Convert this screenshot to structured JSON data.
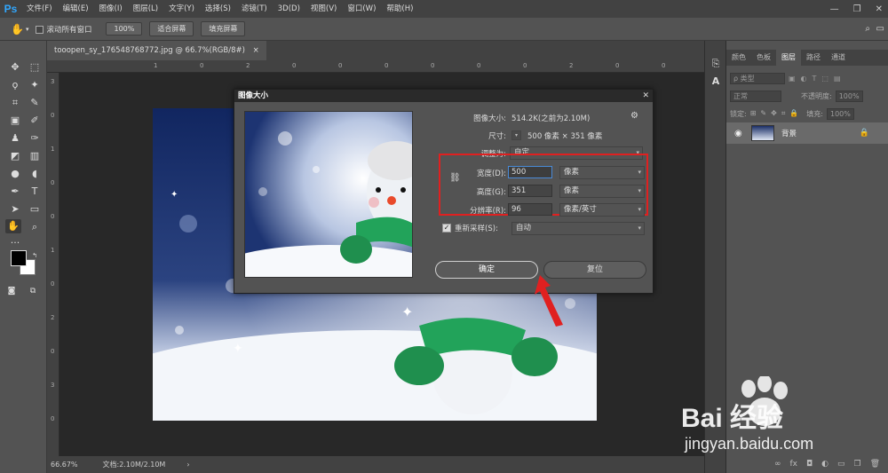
{
  "app": {
    "logo": "Ps",
    "window_controls": [
      "—",
      "❐",
      "✕"
    ]
  },
  "menu": [
    "文件(F)",
    "编辑(E)",
    "图像(I)",
    "图层(L)",
    "文字(Y)",
    "选择(S)",
    "滤镜(T)",
    "3D(D)",
    "视图(V)",
    "窗口(W)",
    "帮助(H)"
  ],
  "options_bar": {
    "scroll_all": "滚动所有窗口",
    "zoom_100": "100%",
    "fit_screen": "适合屏幕",
    "fill_screen": "填充屏幕"
  },
  "document": {
    "tab": "tooopen_sy_176548768772.jpg @ 66.7%(RGB/8#)",
    "close": "×"
  },
  "rulers": {
    "top": [
      "1",
      "0",
      "2",
      "0",
      "0",
      "0",
      "0",
      "0",
      "0",
      "2",
      "0",
      "0"
    ],
    "left": [
      "3",
      "0",
      "1",
      "0",
      "0",
      "1",
      "0",
      "2",
      "0",
      "3",
      "0"
    ]
  },
  "status": {
    "zoom": "66.67%",
    "doc_size": "文档:2.10M/2.10M",
    "more": "›"
  },
  "panel": {
    "tabs": [
      "颜色",
      "色板",
      "图层",
      "路径",
      "通道"
    ],
    "active_tab": "图层",
    "filter_kind": "ρ 类型",
    "blend_mode": "正常",
    "opacity_label": "不透明度:",
    "opacity_value": "100%",
    "lock_label": "锁定:",
    "fill_label": "填充:",
    "fill_value": "100%",
    "layer_name": "背景",
    "bottom_icons": [
      "∞",
      "fx",
      "◘",
      "◐",
      "▭",
      "❐",
      "🗑"
    ]
  },
  "dialog": {
    "title": "图像大小",
    "close": "✕",
    "image_size_label": "图像大小:",
    "image_size_value": "514.2K(之前为2.10M)",
    "dims_label": "尺寸:",
    "dims_value": "500 像素 × 351 像素",
    "fit_to_label": "调整为:",
    "fit_to_value": "自定",
    "width_label": "宽度(D):",
    "width_value": "500",
    "width_unit": "像素",
    "height_label": "高度(G):",
    "height_value": "351",
    "height_unit": "像素",
    "resolution_label": "分辨率(R):",
    "resolution_value": "96",
    "resolution_unit": "像素/英寸",
    "resample_label": "重新采样(S):",
    "resample_value": "自动",
    "ok": "确定",
    "reset": "复位"
  },
  "watermark": {
    "brand": "Bai 经验",
    "url": "jingyan.baidu.com"
  },
  "colors": {
    "accent_red": "#e02020",
    "ps_blue": "#31a8ff",
    "night_blue": "#1b2f66"
  }
}
